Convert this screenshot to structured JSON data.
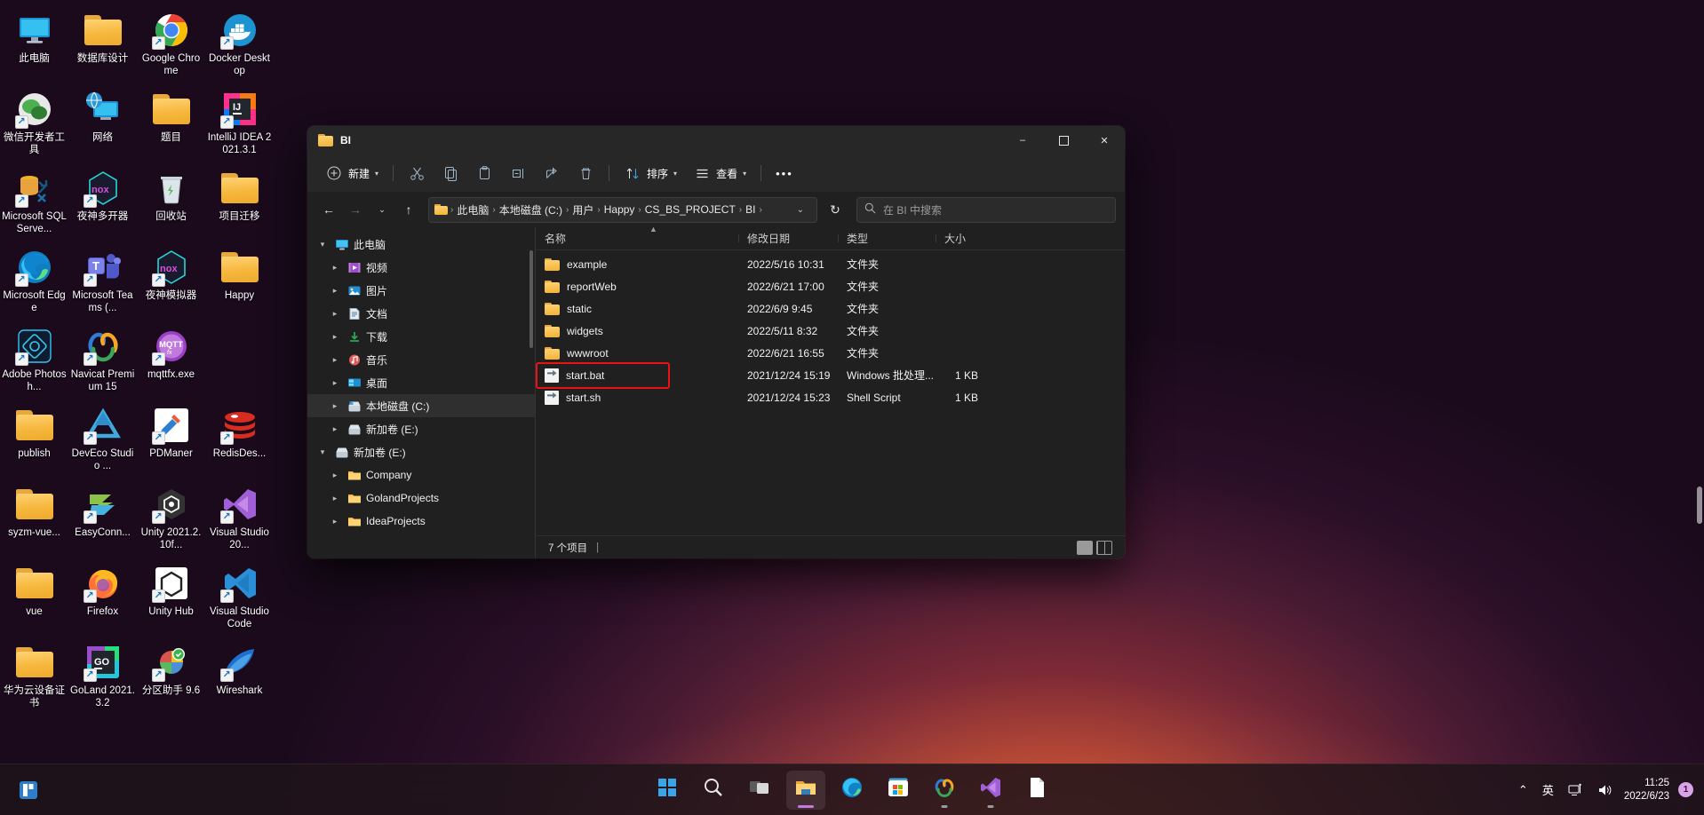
{
  "desktop": {
    "icons": [
      {
        "label": "此电脑",
        "icon": "this-pc-icon",
        "shortcut": false
      },
      {
        "label": "数据库设计",
        "icon": "folder-icon",
        "shortcut": false
      },
      {
        "label": "Google Chrome",
        "icon": "chrome-icon",
        "shortcut": true
      },
      {
        "label": "Docker Desktop",
        "icon": "docker-icon",
        "shortcut": true
      },
      {
        "label": "微信开发者工具",
        "icon": "wechat-devtools-icon",
        "shortcut": true
      },
      {
        "label": "网络",
        "icon": "network-icon",
        "shortcut": false
      },
      {
        "label": "题目",
        "icon": "folder-icon",
        "shortcut": false
      },
      {
        "label": "IntelliJ IDEA 2021.3.1",
        "icon": "intellij-idea-icon",
        "shortcut": true
      },
      {
        "label": "Microsoft SQL Serve...",
        "icon": "sql-server-icon",
        "shortcut": true
      },
      {
        "label": "夜神多开器",
        "icon": "nox-multi-icon",
        "shortcut": true
      },
      {
        "label": "回收站",
        "icon": "recycle-bin-icon",
        "shortcut": false
      },
      {
        "label": "项目迁移",
        "icon": "folder-icon",
        "shortcut": false
      },
      {
        "label": "Microsoft Edge",
        "icon": "edge-icon",
        "shortcut": true
      },
      {
        "label": "Microsoft Teams (...",
        "icon": "teams-icon",
        "shortcut": true
      },
      {
        "label": "夜神模拟器",
        "icon": "nox-player-icon",
        "shortcut": true
      },
      {
        "label": "Happy",
        "icon": "folder-icon",
        "shortcut": false
      },
      {
        "label": "Adobe Photosh...",
        "icon": "photoshop-icon",
        "shortcut": true
      },
      {
        "label": "Navicat Premium 15",
        "icon": "navicat-icon",
        "shortcut": true
      },
      {
        "label": "mqttfx.exe",
        "icon": "mqttfx-icon",
        "shortcut": true
      },
      {
        "label": "",
        "icon": "none",
        "shortcut": false
      },
      {
        "label": "publish",
        "icon": "folder-icon",
        "shortcut": false
      },
      {
        "label": "DevEco Studio ...",
        "icon": "deveco-studio-icon",
        "shortcut": true
      },
      {
        "label": "PDManer",
        "icon": "pdmaner-icon",
        "shortcut": true
      },
      {
        "label": "RedisDes...",
        "icon": "redis-desktop-icon",
        "shortcut": true
      },
      {
        "label": "syzm-vue...",
        "icon": "folder-icon",
        "shortcut": false
      },
      {
        "label": "EasyConn...",
        "icon": "easyconnect-icon",
        "shortcut": true
      },
      {
        "label": "Unity 2021.2.10f...",
        "icon": "unity-icon",
        "shortcut": true
      },
      {
        "label": "Visual Studio 20...",
        "icon": "visual-studio-icon",
        "shortcut": true
      },
      {
        "label": "vue",
        "icon": "folder-icon",
        "shortcut": false
      },
      {
        "label": "Firefox",
        "icon": "firefox-icon",
        "shortcut": true
      },
      {
        "label": "Unity Hub",
        "icon": "unity-hub-icon",
        "shortcut": true
      },
      {
        "label": "Visual Studio Code",
        "icon": "vscode-icon",
        "shortcut": true
      },
      {
        "label": "华为云设备证书",
        "icon": "folder-icon",
        "shortcut": false
      },
      {
        "label": "GoLand 2021.3.2",
        "icon": "goland-icon",
        "shortcut": true
      },
      {
        "label": "分区助手 9.6",
        "icon": "partition-assistant-icon",
        "shortcut": true
      },
      {
        "label": "Wireshark",
        "icon": "wireshark-icon",
        "shortcut": true
      }
    ]
  },
  "explorer": {
    "title": "BI",
    "window_controls": {
      "minimize": "–",
      "maximize": "☐",
      "close": "✕"
    },
    "toolbar": {
      "new_label": "新建",
      "sort_label": "排序",
      "view_label": "查看",
      "more_label": "•••",
      "cut_name": "cut-icon",
      "copy_name": "copy-icon",
      "paste_name": "paste-icon",
      "rename_name": "rename-icon",
      "share_name": "share-icon",
      "delete_name": "delete-icon"
    },
    "address": {
      "back": "←",
      "forward": "→",
      "recent": "⌄",
      "up": "↑",
      "crumbs": [
        "此电脑",
        "本地磁盘 (C:)",
        "用户",
        "Happy",
        "CS_BS_PROJECT",
        "BI"
      ],
      "separator": "›",
      "dropdown": "⌄",
      "refresh": "↻"
    },
    "search": {
      "placeholder": "在 BI 中搜索",
      "icon": "search-icon"
    },
    "nav_tree": [
      {
        "label": "此电脑",
        "depth": 1,
        "twisty": "⌄",
        "icon": "this-pc-icon",
        "selected": false
      },
      {
        "label": "视频",
        "depth": 2,
        "twisty": "›",
        "icon": "videos-icon",
        "selected": false
      },
      {
        "label": "图片",
        "depth": 2,
        "twisty": "›",
        "icon": "pictures-icon",
        "selected": false
      },
      {
        "label": "文档",
        "depth": 2,
        "twisty": "›",
        "icon": "documents-icon",
        "selected": false
      },
      {
        "label": "下载",
        "depth": 2,
        "twisty": "›",
        "icon": "downloads-icon",
        "selected": false
      },
      {
        "label": "音乐",
        "depth": 2,
        "twisty": "›",
        "icon": "music-icon",
        "selected": false
      },
      {
        "label": "桌面",
        "depth": 2,
        "twisty": "›",
        "icon": "desktop-icon",
        "selected": false
      },
      {
        "label": "本地磁盘 (C:)",
        "depth": 2,
        "twisty": "›",
        "icon": "local-disk-icon",
        "selected": true
      },
      {
        "label": "新加卷 (E:)",
        "depth": 2,
        "twisty": "›",
        "icon": "drive-icon",
        "selected": false
      },
      {
        "label": "新加卷 (E:)",
        "depth": 1,
        "twisty": "⌄",
        "icon": "drive-icon",
        "selected": false
      },
      {
        "label": "Company",
        "depth": 2,
        "twisty": "›",
        "icon": "folder-icon",
        "selected": false
      },
      {
        "label": "GolandProjects",
        "depth": 2,
        "twisty": "›",
        "icon": "folder-icon",
        "selected": false
      },
      {
        "label": "IdeaProjects",
        "depth": 2,
        "twisty": "›",
        "icon": "folder-icon",
        "selected": false
      }
    ],
    "columns": {
      "name": "名称",
      "date": "修改日期",
      "type": "类型",
      "size": "大小"
    },
    "files": [
      {
        "name": "example",
        "date": "2022/5/16 10:31",
        "type": "文件夹",
        "size": "",
        "icon": "folder-icon",
        "highlighted": false
      },
      {
        "name": "reportWeb",
        "date": "2022/6/21 17:00",
        "type": "文件夹",
        "size": "",
        "icon": "folder-icon",
        "highlighted": false
      },
      {
        "name": "static",
        "date": "2022/6/9 9:45",
        "type": "文件夹",
        "size": "",
        "icon": "folder-icon",
        "highlighted": false
      },
      {
        "name": "widgets",
        "date": "2022/5/11 8:32",
        "type": "文件夹",
        "size": "",
        "icon": "folder-icon",
        "highlighted": false
      },
      {
        "name": "wwwroot",
        "date": "2022/6/21 16:55",
        "type": "文件夹",
        "size": "",
        "icon": "folder-icon",
        "highlighted": false
      },
      {
        "name": "start.bat",
        "date": "2021/12/24 15:19",
        "type": "Windows 批处理...",
        "size": "1 KB",
        "icon": "script-icon",
        "highlighted": true
      },
      {
        "name": "start.sh",
        "date": "2021/12/24 15:23",
        "type": "Shell Script",
        "size": "1 KB",
        "icon": "script-icon",
        "highlighted": false
      }
    ],
    "status": {
      "item_count": "7 个项目"
    },
    "accent_highlight_color": "#ee1111"
  },
  "taskbar": {
    "items": [
      {
        "name": "start-button",
        "icon": "windows-logo-icon",
        "active": false,
        "running": false
      },
      {
        "name": "search-button",
        "icon": "search-icon",
        "active": false,
        "running": false
      },
      {
        "name": "task-view-button",
        "icon": "task-view-icon",
        "active": false,
        "running": false
      },
      {
        "name": "file-explorer-button",
        "icon": "file-explorer-icon",
        "active": true,
        "running": true
      },
      {
        "name": "edge-button",
        "icon": "edge-icon",
        "active": false,
        "running": false
      },
      {
        "name": "store-button",
        "icon": "microsoft-store-icon",
        "active": false,
        "running": false
      },
      {
        "name": "navicat-button",
        "icon": "navicat-icon",
        "active": false,
        "running": true
      },
      {
        "name": "visual-studio-button",
        "icon": "visual-studio-icon",
        "active": false,
        "running": true
      },
      {
        "name": "notepad-button",
        "icon": "notepad-icon",
        "active": false,
        "running": false
      }
    ],
    "tray": {
      "overflow": "⌃",
      "ime": "英",
      "network": "network-icon",
      "volume": "volume-icon",
      "time": "11:25",
      "date": "2022/6/23",
      "notification_count": "1"
    }
  }
}
